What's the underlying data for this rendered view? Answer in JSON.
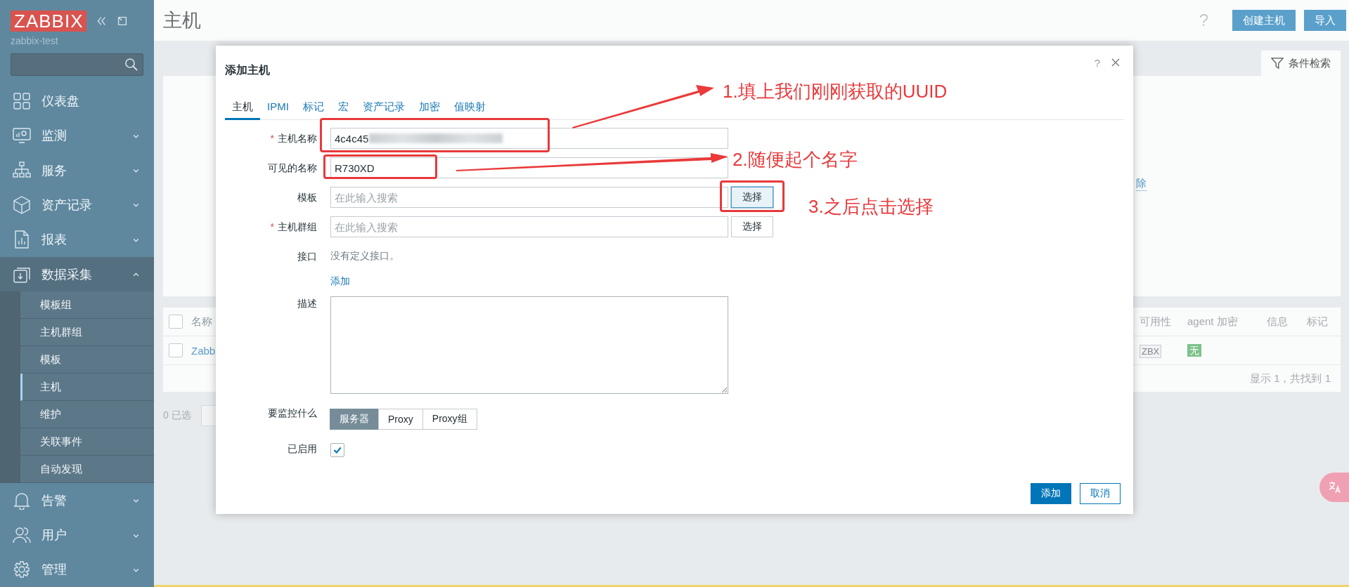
{
  "sidebar": {
    "logo": "ZABBIX",
    "server": "zabbix-test",
    "items": [
      {
        "label": "仪表盘"
      },
      {
        "label": "监测",
        "expanded": false
      },
      {
        "label": "服务",
        "expanded": false
      },
      {
        "label": "资产记录",
        "expanded": false
      },
      {
        "label": "报表",
        "expanded": false
      },
      {
        "label": "数据采集",
        "expanded": true,
        "children": [
          {
            "label": "模板组",
            "selected": false
          },
          {
            "label": "主机群组",
            "selected": false
          },
          {
            "label": "模板",
            "selected": false
          },
          {
            "label": "主机",
            "selected": true
          },
          {
            "label": "维护",
            "selected": false
          },
          {
            "label": "关联事件",
            "selected": false
          },
          {
            "label": "自动发现",
            "selected": false
          }
        ]
      },
      {
        "label": "告警",
        "expanded": false
      },
      {
        "label": "用户",
        "expanded": false
      },
      {
        "label": "管理",
        "expanded": false
      }
    ]
  },
  "page": {
    "title": "主机",
    "help": "?",
    "buttons": [
      "创建主机",
      "导入"
    ],
    "filter_tab": "条件检索",
    "remove_link": "除",
    "table": {
      "select_all_checked": false,
      "name_column": "名称",
      "columns": [
        "可用性",
        "agent 加密",
        "信息",
        "标记"
      ],
      "rows": [
        {
          "checked": false,
          "name": "Zabb",
          "availability": "ZBX",
          "encryption": "无"
        }
      ],
      "footer": "显示 1，共找到 1"
    },
    "selected_count": "0 已选"
  },
  "dialog": {
    "title": "添加主机",
    "help": "?",
    "required_mark": "*",
    "tabs": [
      {
        "label": "主机",
        "selected": true
      },
      {
        "label": "IPMI",
        "selected": false
      },
      {
        "label": "标记",
        "selected": false
      },
      {
        "label": "宏",
        "selected": false
      },
      {
        "label": "资产记录",
        "selected": false
      },
      {
        "label": "加密",
        "selected": false
      },
      {
        "label": "值映射",
        "selected": false
      }
    ],
    "fields": [
      {
        "kind": "text",
        "label": "主机名称",
        "required": true,
        "value": "4c4c45",
        "blurred": true
      },
      {
        "kind": "text",
        "label": "可见的名称",
        "required": false,
        "value": "R730XD"
      },
      {
        "kind": "multiselect",
        "label": "模板",
        "required": false,
        "placeholder": "在此输入搜索",
        "button": "选择",
        "focused": true
      },
      {
        "kind": "multiselect",
        "label": "主机群组",
        "required": true,
        "placeholder": "在此输入搜索",
        "button": "选择",
        "focused": false
      },
      {
        "kind": "static",
        "label": "接口",
        "text": "没有定义接口。",
        "link": "添加"
      },
      {
        "kind": "textarea",
        "label": "描述"
      },
      {
        "kind": "segmented",
        "label": "要监控什么",
        "options": [
          {
            "label": "服务器",
            "selected": true
          },
          {
            "label": "Proxy",
            "selected": false
          },
          {
            "label": "Proxy组",
            "selected": false
          }
        ]
      },
      {
        "kind": "checkbox",
        "label": "已启用",
        "checked": true
      }
    ],
    "buttons": [
      {
        "label": "添加",
        "primary": true
      },
      {
        "label": "取消",
        "primary": false
      }
    ]
  },
  "annotations": [
    "1.填上我们刚刚获取的UUID",
    "2.随便起个名字",
    "3.之后点击选择"
  ]
}
